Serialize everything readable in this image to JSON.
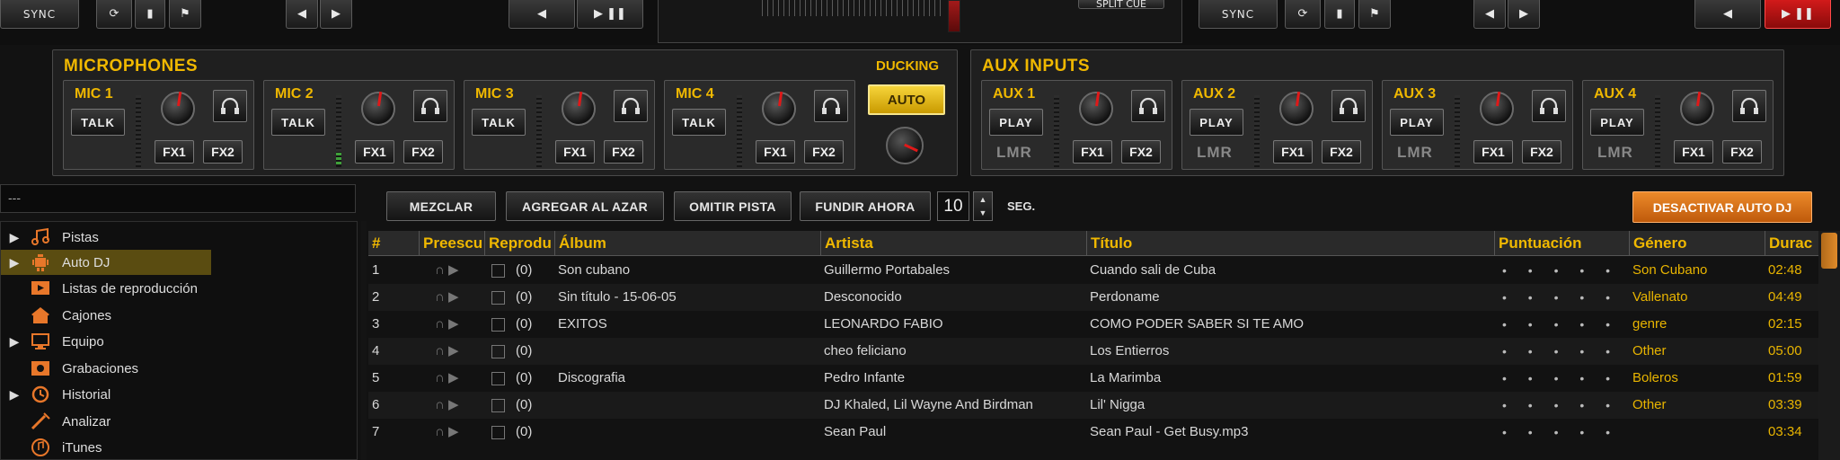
{
  "deck_left": {
    "sync_label": "SYNC",
    "buttons": [
      "⟳",
      "▮",
      "⚑",
      "◀",
      "▶",
      "◀",
      "▶ ❚❚"
    ]
  },
  "center": {
    "split_cue_label": "SPLIT CUE"
  },
  "deck_right": {
    "sync_label": "SYNC",
    "play_pause": "▶ ❚❚"
  },
  "microphones": {
    "title": "MICROPHONES",
    "ducking_label": "DUCKING",
    "ducking_button": "AUTO",
    "channels": [
      {
        "name": "MIC 1",
        "button": "TALK",
        "fx1": "FX1",
        "fx2": "FX2"
      },
      {
        "name": "MIC 2",
        "button": "TALK",
        "fx1": "FX1",
        "fx2": "FX2"
      },
      {
        "name": "MIC 3",
        "button": "TALK",
        "fx1": "FX1",
        "fx2": "FX2"
      },
      {
        "name": "MIC 4",
        "button": "TALK",
        "fx1": "FX1",
        "fx2": "FX2"
      }
    ]
  },
  "aux": {
    "title": "AUX INPUTS",
    "channels": [
      {
        "name": "AUX 1",
        "button": "PLAY",
        "lmr": "LMR",
        "fx1": "FX1",
        "fx2": "FX2"
      },
      {
        "name": "AUX 2",
        "button": "PLAY",
        "lmr": "LMR",
        "fx1": "FX1",
        "fx2": "FX2"
      },
      {
        "name": "AUX 3",
        "button": "PLAY",
        "lmr": "LMR",
        "fx1": "FX1",
        "fx2": "FX2"
      },
      {
        "name": "AUX 4",
        "button": "PLAY",
        "lmr": "LMR",
        "fx1": "FX1",
        "fx2": "FX2"
      }
    ]
  },
  "search": {
    "value": "---"
  },
  "tree": [
    {
      "label": "Pistas",
      "caret": "▶",
      "icon": "music-note-icon"
    },
    {
      "label": "Auto DJ",
      "caret": "▶",
      "icon": "robot-icon",
      "selected": true
    },
    {
      "label": "Listas de reproducción",
      "caret": "",
      "icon": "playlist-icon"
    },
    {
      "label": "Cajones",
      "caret": "",
      "icon": "crate-icon"
    },
    {
      "label": "Equipo",
      "caret": "▶",
      "icon": "computer-icon"
    },
    {
      "label": "Grabaciones",
      "caret": "",
      "icon": "recording-icon"
    },
    {
      "label": "Historial",
      "caret": "▶",
      "icon": "history-icon"
    },
    {
      "label": "Analizar",
      "caret": "",
      "icon": "analyze-icon"
    },
    {
      "label": "iTunes",
      "caret": "",
      "icon": "itunes-icon"
    }
  ],
  "toolbar": {
    "mezclar": "MEZCLAR",
    "agregar": "AGREGAR AL AZAR",
    "omitir": "OMITIR PISTA",
    "fundir": "FUNDIR AHORA",
    "seconds_value": "10",
    "seconds_label": "SEG.",
    "spin_up": "▲",
    "spin_down": "▼",
    "autodj": "DESACTIVAR AUTO DJ"
  },
  "table": {
    "columns": [
      "#",
      "Preescu",
      "Reprodu",
      "Álbum",
      "Artista",
      "Título",
      "Puntuación",
      "Género",
      "Durac"
    ],
    "rows": [
      {
        "n": "1",
        "plays": "(0)",
        "album": "Son cubano",
        "artist": "Guillermo Portabales",
        "title": "Cuando sali de Cuba",
        "rating": "• • • • •",
        "genre": "Son Cubano",
        "dur": "02:48"
      },
      {
        "n": "2",
        "plays": "(0)",
        "album": "Sin título - 15-06-05",
        "artist": "Desconocido",
        "title": "Perdoname",
        "rating": "• • • • •",
        "genre": "Vallenato",
        "dur": "04:49"
      },
      {
        "n": "3",
        "plays": "(0)",
        "album": "EXITOS",
        "artist": "LEONARDO FABIO",
        "title": "COMO PODER SABER SI TE AMO",
        "rating": "• • • • •",
        "genre": "genre",
        "dur": "02:15"
      },
      {
        "n": "4",
        "plays": "(0)",
        "album": "",
        "artist": "cheo feliciano",
        "title": "Los Entierros",
        "rating": "• • • • •",
        "genre": "Other",
        "dur": "05:00"
      },
      {
        "n": "5",
        "plays": "(0)",
        "album": "Discografia",
        "artist": "Pedro Infante",
        "title": "La Marimba",
        "rating": "• • • • •",
        "genre": "Boleros",
        "dur": "01:59"
      },
      {
        "n": "6",
        "plays": "(0)",
        "album": "",
        "artist": "DJ Khaled, Lil Wayne And Birdman",
        "title": "Lil' Nigga",
        "rating": "• • • • •",
        "genre": "Other",
        "dur": "03:39"
      },
      {
        "n": "7",
        "plays": "(0)",
        "album": "",
        "artist": "Sean Paul",
        "title": "Sean Paul - Get Busy.mp3",
        "rating": "• • • • •",
        "genre": "",
        "dur": "03:34"
      }
    ]
  },
  "colors": {
    "accent_yellow": "#f0b800",
    "accent_orange": "#e07a1a",
    "deck_red": "#c81414",
    "selected_row": "#5a4c11"
  }
}
